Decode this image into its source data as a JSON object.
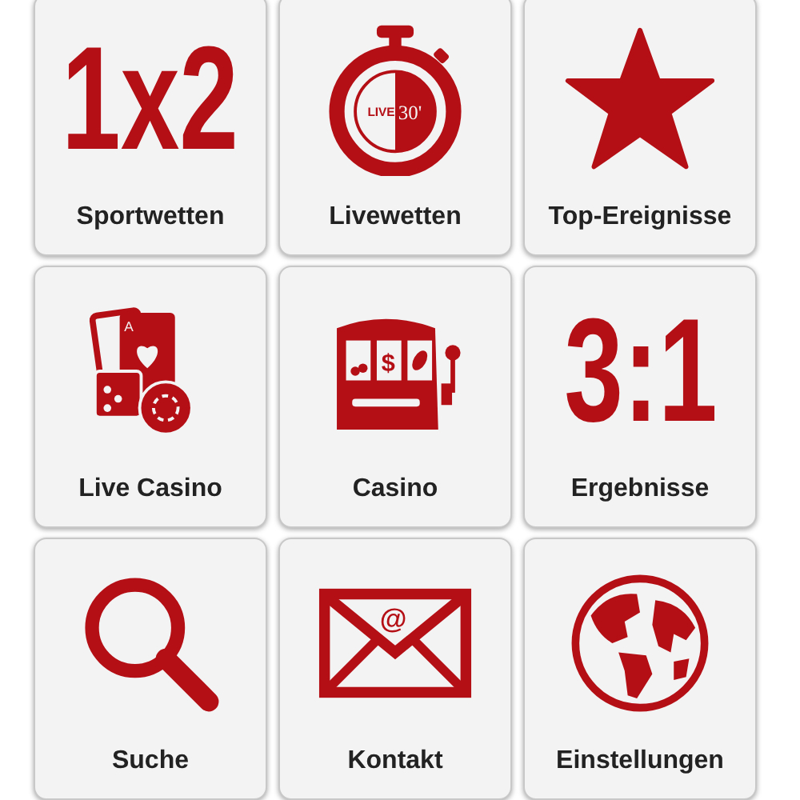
{
  "tiles": [
    {
      "label": "Sportwetten",
      "kind": "glyph",
      "icon_texts": [
        "1x2"
      ]
    },
    {
      "label": "Livewetten",
      "kind": "stopwatch",
      "icon_texts": [
        "LIVE",
        "30'"
      ]
    },
    {
      "label": "Top-Ereignisse",
      "kind": "star"
    },
    {
      "label": "Live Casino",
      "kind": "cards",
      "icon_texts": [
        "A"
      ]
    },
    {
      "label": "Casino",
      "kind": "slot",
      "icon_texts": [
        "$"
      ]
    },
    {
      "label": "Ergebnisse",
      "kind": "glyph",
      "icon_texts": [
        "3:1"
      ]
    },
    {
      "label": "Suche",
      "kind": "search"
    },
    {
      "label": "Kontakt",
      "kind": "mail",
      "icon_texts": [
        "@"
      ]
    },
    {
      "label": "Einstellungen",
      "kind": "globe"
    }
  ]
}
